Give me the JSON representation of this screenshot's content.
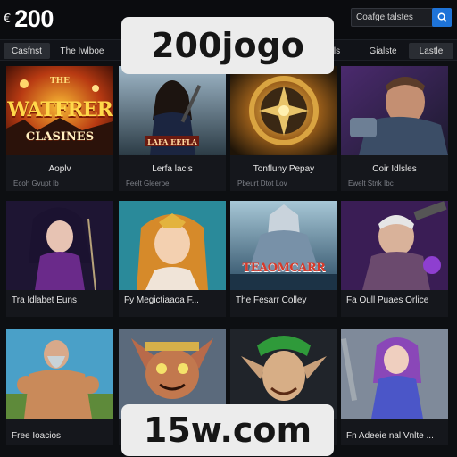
{
  "header": {
    "logo_text": "200",
    "search_text": "Coafge talstes"
  },
  "nav": {
    "tabs": [
      {
        "label": "Casfnst",
        "active": true
      },
      {
        "label": "The Iwlboe",
        "active": false
      },
      {
        "label": "sls",
        "active": false
      },
      {
        "label": "Gialste",
        "active": false
      },
      {
        "label": "Lastle",
        "active": true
      }
    ]
  },
  "games_row1": [
    {
      "art_label_top": "THE",
      "art_label_main": "WATFRER",
      "art_label_sub": "CLASINES",
      "title": "Aoplv",
      "subtitle": "Ecoh Gvupt Ib"
    },
    {
      "art_label_main": "LAFA EEFLA",
      "title": "Lerfa lacis",
      "subtitle": "Feelt Gleeroe"
    },
    {
      "title": "Tonfluny Pepay",
      "subtitle": "Pbeurt Dtot Lov"
    },
    {
      "title": "Coir Idlsles",
      "subtitle": "Ewelt Stnk Ibc"
    }
  ],
  "games_row2": [
    {
      "title": "Tra Idlabet Euns"
    },
    {
      "title": "Fy Megictiaaoa F..."
    },
    {
      "art_label_main": "TEAOMCARR",
      "title": "The Fesarr Colley"
    },
    {
      "title": "Fa Oull Puaes Orlice"
    }
  ],
  "games_row3": [
    {
      "title": "Free Ioacios"
    },
    {
      "title": "15w.com"
    },
    {
      "title": ""
    },
    {
      "title": "Fn Adeeie nal Vnlte ..."
    }
  ],
  "overlays": {
    "top_banner": "200jogo",
    "bottom_banner": "15w.com"
  },
  "colors": {
    "accent_blue": "#1e73d8",
    "background": "#0d0f12",
    "card": "#15171c"
  }
}
